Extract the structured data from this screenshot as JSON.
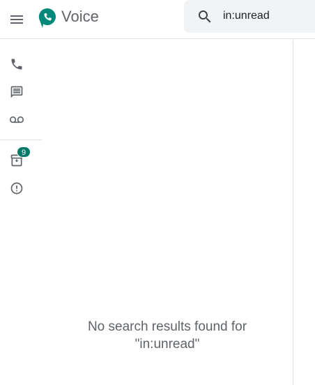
{
  "header": {
    "menu_icon": "menu-icon",
    "logo_icon": "google-voice-logo",
    "app_name": "Voice",
    "search": {
      "icon": "search-icon",
      "value": "in:unread"
    }
  },
  "sidebar": {
    "items": [
      {
        "icon": "phone-icon"
      },
      {
        "icon": "message-icon"
      },
      {
        "icon": "voicemail-icon"
      },
      {
        "icon": "archive-icon",
        "badge": "9"
      },
      {
        "icon": "spam-icon"
      }
    ]
  },
  "main": {
    "empty_line1": "No search results found for",
    "empty_line2": "\"in:unread\""
  },
  "colors": {
    "brand": "#00796b",
    "icon": "#5f6368",
    "text_secondary": "#5f6368",
    "search_bg": "#f1f3f4",
    "divider": "#e0e0e0"
  }
}
